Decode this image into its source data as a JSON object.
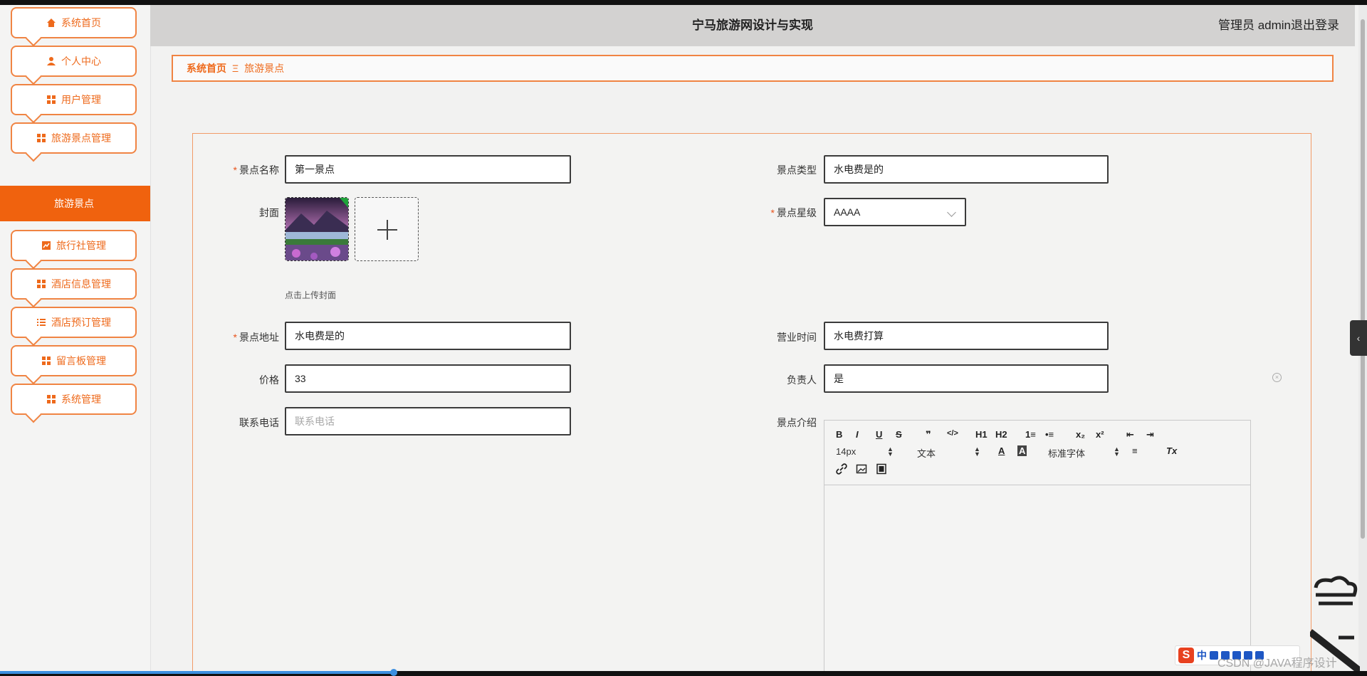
{
  "header": {
    "title": "宁马旅游网设计与实现",
    "user": "管理员 admin",
    "logout": "退出登录"
  },
  "sidebar": {
    "items": [
      {
        "label": "系统首页",
        "icon": "home-icon"
      },
      {
        "label": "个人中心",
        "icon": "user-icon"
      },
      {
        "label": "用户管理",
        "icon": "grid-icon"
      },
      {
        "label": "旅游景点管理",
        "icon": "grid-icon"
      },
      {
        "label": "旅行社管理",
        "icon": "chart-icon"
      },
      {
        "label": "酒店信息管理",
        "icon": "grid-icon"
      },
      {
        "label": "酒店预订管理",
        "icon": "list-icon"
      },
      {
        "label": "留言板管理",
        "icon": "grid-icon"
      },
      {
        "label": "系统管理",
        "icon": "grid-icon"
      }
    ],
    "active_sub": "旅游景点"
  },
  "breadcrumb": {
    "home": "系统首页",
    "sep": "Ξ",
    "current": "旅游景点"
  },
  "form": {
    "name": {
      "label": "景点名称",
      "value": "第一景点"
    },
    "type": {
      "label": "景点类型",
      "value": "水电费是的"
    },
    "cover": {
      "label": "封面",
      "hint": "点击上传封面"
    },
    "level": {
      "label": "景点星级",
      "value": "AAAA"
    },
    "address": {
      "label": "景点地址",
      "value": "水电费是的"
    },
    "hours": {
      "label": "营业时间",
      "value": "水电费打算"
    },
    "price": {
      "label": "价格",
      "value": "33"
    },
    "manager": {
      "label": "负责人",
      "value": "是"
    },
    "phone": {
      "label": "联系电话",
      "placeholder": "联系电话"
    },
    "intro": {
      "label": "景点介绍"
    },
    "required_mark": "*"
  },
  "editor": {
    "toolbar_row1": [
      "B",
      "I",
      "U",
      "S",
      "❞",
      "</>",
      "H1",
      "H2",
      "1≡",
      "•≡",
      "x₂",
      "x²",
      "⇤",
      "⇥"
    ],
    "font_size": "14px",
    "block_type": "文本",
    "font_family": "标准字体",
    "color_btn": "A",
    "bg_btn": "A",
    "align_btn": "≡",
    "clear_btn": "Tx"
  },
  "watermark": "CSDN @JAVA程序设计",
  "ime": {
    "logo": "S",
    "lang": "中"
  },
  "colors": {
    "accent": "#f0620e",
    "border": "#f08443"
  }
}
